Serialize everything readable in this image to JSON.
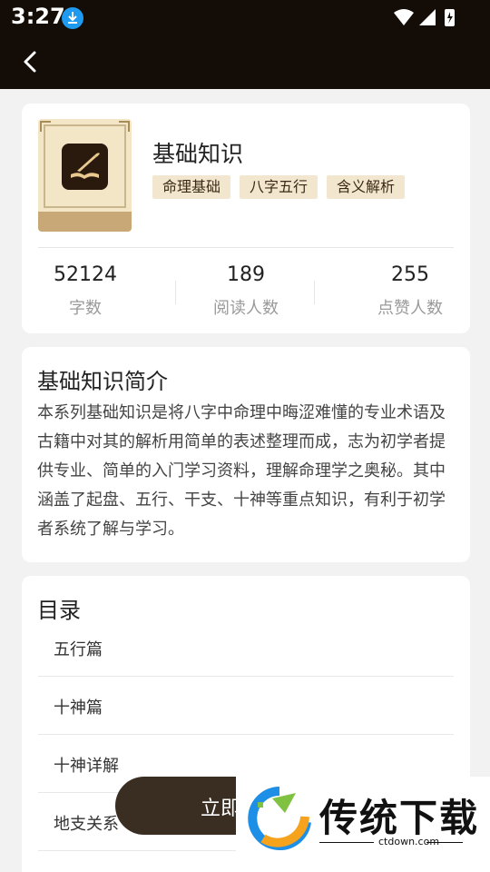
{
  "status_bar": {
    "time": "3:27"
  },
  "book": {
    "title": "基础知识",
    "tags": [
      "命理基础",
      "八字五行",
      "含义解析"
    ],
    "stats": [
      {
        "value": "52124",
        "label": "字数"
      },
      {
        "value": "189",
        "label": "阅读人数"
      },
      {
        "value": "255",
        "label": "点赞人数"
      }
    ]
  },
  "intro": {
    "heading": "基础知识简介",
    "text": "本系列基础知识是将八字中命理中晦涩难懂的专业术语及古籍中对其的解析用简单的表述整理而成，志为初学者提供专业、简单的入门学习资料，理解命理学之奥秘。其中涵盖了起盘、五行、干支、十神等重点知识，有利于初学者系统了解与学习。"
  },
  "toc": {
    "heading": "目录",
    "items": [
      "五行篇",
      "十神篇",
      "十神详解",
      "地支关系"
    ]
  },
  "read_button": {
    "label": "立即"
  },
  "watermark": {
    "brand": "传统下载",
    "url": "ctdown.com"
  },
  "colors": {
    "header_bg": "#140c06",
    "tag_bg": "#f2e6cf",
    "button_bg": "#3a2d22"
  }
}
